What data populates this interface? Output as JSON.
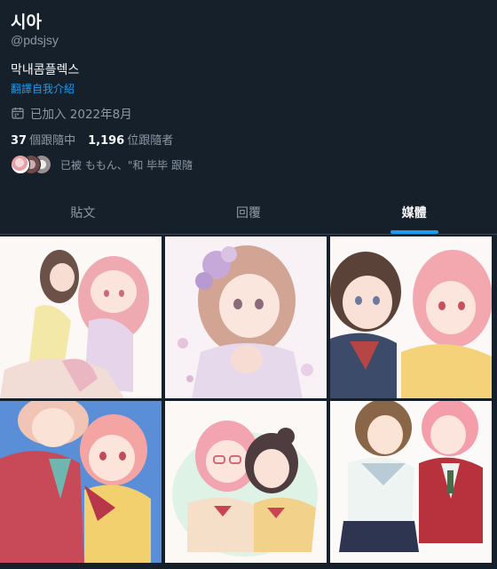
{
  "profile": {
    "display_name": "시아",
    "handle": "@pdsjsy",
    "bio": "막내콤플렉스",
    "translate_link": "翻譯自我介紹",
    "joined": "已加入 2022年8月",
    "following_count": "37",
    "following_label": "個跟隨中",
    "followers_count": "1,196",
    "followers_label": "位跟隨者",
    "followed_by": "已被 ももん、\"和 毕毕 跟隨"
  },
  "tabs": [
    {
      "label": "貼文",
      "active": false
    },
    {
      "label": "回覆",
      "active": false
    },
    {
      "label": "媒體",
      "active": true
    }
  ],
  "colors": {
    "background": "#15202b",
    "accent": "#1d9bf0",
    "secondary_text": "#8b98a5",
    "divider": "#38444d"
  },
  "media_grid": {
    "columns": 3,
    "items": [
      {
        "icon": "artwork-two-girls-sitting"
      },
      {
        "icon": "artwork-girl-flower-hair"
      },
      {
        "icon": "artwork-two-girls-school"
      },
      {
        "icon": "artwork-couple-red-jacket"
      },
      {
        "icon": "artwork-girls-glasses"
      },
      {
        "icon": "artwork-girls-uniform"
      }
    ]
  }
}
